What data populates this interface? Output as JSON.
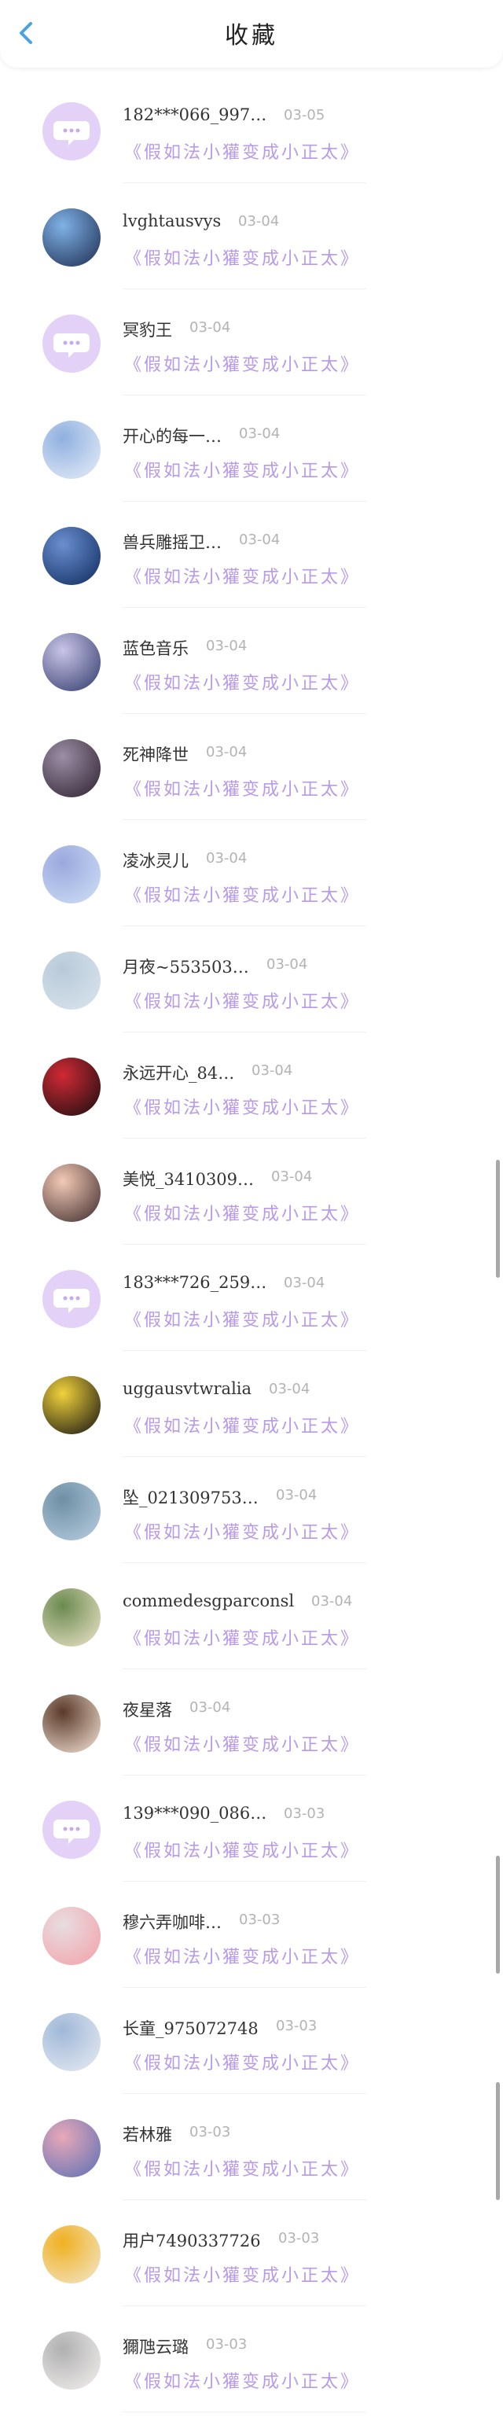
{
  "header": {
    "title": "收藏",
    "back_icon": "chevron-left-icon"
  },
  "colors": {
    "accent": "#4aa3df",
    "tag": "#b89ae8",
    "date": "#b3b3b3",
    "avatar_bg": "#e3d1f7"
  },
  "collection_tag": "《假如法小獾变成小正太》",
  "items": [
    {
      "name": "182***066_997…",
      "date": "03-05",
      "avatar": "chat-bubble-icon"
    },
    {
      "name": "lvghtausvys",
      "date": "03-04",
      "avatar": "user-photo"
    },
    {
      "name": "冥豹王",
      "date": "03-04",
      "avatar": "chat-bubble-icon"
    },
    {
      "name": "开心的每一…",
      "date": "03-04",
      "avatar": "user-photo"
    },
    {
      "name": "兽兵雕摇卫…",
      "date": "03-04",
      "avatar": "user-photo"
    },
    {
      "name": "蓝色音乐",
      "date": "03-04",
      "avatar": "user-photo"
    },
    {
      "name": "死神降世",
      "date": "03-04",
      "avatar": "user-photo"
    },
    {
      "name": "凌冰灵儿",
      "date": "03-04",
      "avatar": "user-photo"
    },
    {
      "name": "月夜~553503…",
      "date": "03-04",
      "avatar": "user-photo"
    },
    {
      "name": "永远开心_84…",
      "date": "03-04",
      "avatar": "user-photo"
    },
    {
      "name": "美悦_3410309…",
      "date": "03-04",
      "avatar": "user-photo"
    },
    {
      "name": "183***726_259…",
      "date": "03-04",
      "avatar": "chat-bubble-icon"
    },
    {
      "name": "uggausvtwralia",
      "date": "03-04",
      "avatar": "user-photo"
    },
    {
      "name": "坠_021309753…",
      "date": "03-04",
      "avatar": "user-photo"
    },
    {
      "name": "commedesgparconsl",
      "date": "03-04",
      "avatar": "user-photo"
    },
    {
      "name": "夜星落",
      "date": "03-04",
      "avatar": "user-photo"
    },
    {
      "name": "139***090_086…",
      "date": "03-03",
      "avatar": "chat-bubble-icon"
    },
    {
      "name": "穆六弄咖啡…",
      "date": "03-03",
      "avatar": "user-photo"
    },
    {
      "name": "长童_975072748",
      "date": "03-03",
      "avatar": "user-photo"
    },
    {
      "name": "若林雅",
      "date": "03-03",
      "avatar": "user-photo"
    },
    {
      "name": "用户7490337726",
      "date": "03-03",
      "avatar": "user-photo"
    },
    {
      "name": "獮虺云璐",
      "date": "03-03",
      "avatar": "user-photo"
    }
  ]
}
